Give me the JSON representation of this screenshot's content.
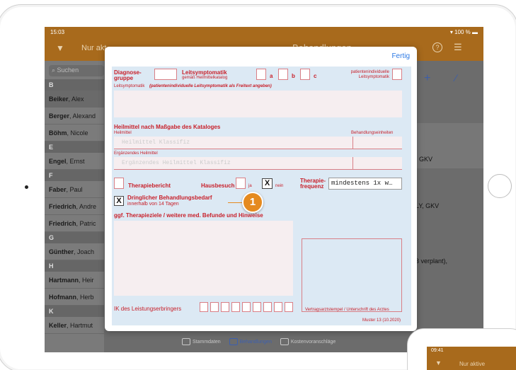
{
  "status": {
    "time": "15:03",
    "battery": "100 %"
  },
  "nav": {
    "filter_label": "Nur akt",
    "title": "Behandlungen"
  },
  "sidebar": {
    "search_placeholder": "Suchen",
    "rows": [
      {
        "type": "header",
        "text": "B"
      },
      {
        "type": "row",
        "last": "Beiker",
        "first": ", Alex",
        "selected": true
      },
      {
        "type": "row",
        "last": "Berger",
        "first": ", Alexand"
      },
      {
        "type": "row",
        "last": "Böhm",
        "first": ", Nicole"
      },
      {
        "type": "header",
        "text": "E"
      },
      {
        "type": "row",
        "last": "Engel",
        "first": ", Ernst"
      },
      {
        "type": "header",
        "text": "F"
      },
      {
        "type": "row",
        "last": "Faber",
        "first": ", Paul"
      },
      {
        "type": "row",
        "last": "Friedrich",
        "first": ", Andre"
      },
      {
        "type": "row",
        "last": "Friedrich",
        "first": ", Patric"
      },
      {
        "type": "header",
        "text": "G"
      },
      {
        "type": "row",
        "last": "Günther",
        "first": ", Joach"
      },
      {
        "type": "header",
        "text": "H"
      },
      {
        "type": "row",
        "last": "Hartmann",
        "first": ", Heir"
      },
      {
        "type": "row",
        "last": "Hofmann",
        "first": ", Herb"
      },
      {
        "type": "header",
        "text": "K"
      },
      {
        "type": "row",
        "last": "Keller",
        "first": ", Hartmut"
      }
    ]
  },
  "right": {
    "t1": ", GKV",
    "t2": "LY, GKV",
    "t3": "3 verplant),"
  },
  "tabs": [
    "Stammdaten",
    "Behandlungen",
    "Kostenvoranschläge"
  ],
  "modal": {
    "done": "Fertig"
  },
  "form": {
    "diagnose_gruppe": "Diagnose-\ngruppe",
    "leitsymptomatik": "Leitsymptomatik",
    "leitsymptomatik_sub": "gemäß Heilmittelkatalog",
    "a": "a",
    "b": "b",
    "c": "c",
    "patient_individual": "patientenindividuelle\nLeitsymptomatik",
    "leitsymptomatik_line": "Leitsymptomatik",
    "leitsymptomatik_line_note": "(patientenindividuelle Leitsymptomatik als Freitext angeben)",
    "heilmittel_title": "Heilmittel nach Maßgabe des Kataloges",
    "heilmittel_label": "Heilmittel",
    "behandlungseinheiten": "Behandlungseinheiten",
    "heilmittel_ghost": "Heilmittel Klassifiz",
    "ergaenzendes": "Ergänzendes Heilmittel",
    "ergaenzendes_ghost": "Ergänzendes Heilmittel Klassifiz",
    "therapiebericht": "Therapiebericht",
    "hausbesuch": "Hausbesuch",
    "ja": "ja",
    "nein": "nein",
    "x_mark": "X",
    "therapie_frequenz": "Therapie-\nfrequenz",
    "frequenz_value": "mindestens 1x w…",
    "dringlich_title": "Dringlicher Behandlungsbedarf",
    "dringlich_sub": "innerhalb von 14 Tagen",
    "therapieziele": "ggf. Therapieziele / weitere med. Befunde und Hinweise",
    "ik": "IK des Leistungserbringers",
    "stempel": "Vertragsarztstempel / Unterschrift des Arztes",
    "muster": "Muster 13 (10.2020)"
  },
  "callout": {
    "number": "1"
  },
  "phone": {
    "time": "09:41",
    "label": "Nur aktive"
  }
}
